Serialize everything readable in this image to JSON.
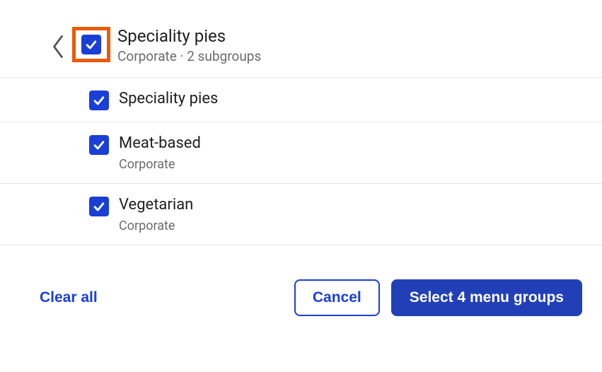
{
  "header": {
    "title": "Speciality pies",
    "subtitle": "Corporate · 2 subgroups"
  },
  "items": [
    {
      "title": "Speciality pies",
      "subtitle": ""
    },
    {
      "title": "Meat-based",
      "subtitle": "Corporate"
    },
    {
      "title": "Vegetarian",
      "subtitle": "Corporate"
    }
  ],
  "footer": {
    "clear": "Clear all",
    "cancel": "Cancel",
    "select": "Select 4 menu groups"
  }
}
